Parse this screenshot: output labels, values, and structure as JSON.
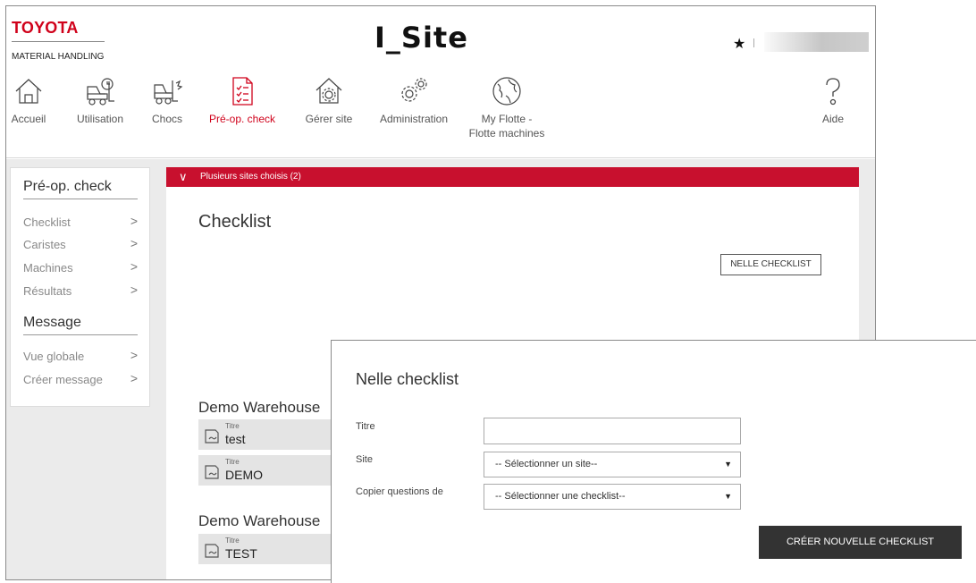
{
  "brand": {
    "name": "TOYOTA",
    "division": "MATERIAL HANDLING"
  },
  "header": {
    "app_title": "I_Site",
    "favorite_symbol": "★"
  },
  "nav": {
    "items": [
      {
        "label": "Accueil",
        "icon": "home-icon"
      },
      {
        "label": "Utilisation",
        "icon": "forklift-clock-icon"
      },
      {
        "label": "Chocs",
        "icon": "forklift-impact-icon"
      },
      {
        "label": "Pré-op. check",
        "icon": "checklist-icon",
        "active": true
      },
      {
        "label": "Gérer site",
        "icon": "house-gear-icon"
      },
      {
        "label": "Administration",
        "icon": "gears-icon"
      },
      {
        "label": "My Flotte -\nFlotte machines",
        "label_line1": "My Flotte -",
        "label_line2": "Flotte machines",
        "icon": "globe-icon"
      },
      {
        "label": "Aide",
        "icon": "help-icon"
      }
    ]
  },
  "sidebar": {
    "section1": {
      "title": "Pré-op. check",
      "items": [
        "Checklist",
        "Caristes",
        "Machines",
        "Résultats"
      ]
    },
    "section2": {
      "title": "Message",
      "items": [
        "Vue globale",
        "Créer message"
      ]
    },
    "chevron": ">"
  },
  "content": {
    "site_selector": "Plusieurs sites choisis (2)",
    "title": "Checklist",
    "new_button": "NELLE CHECKLIST",
    "groups": [
      {
        "name": "Demo Warehouse",
        "cards": [
          {
            "label": "Titre",
            "value": "test"
          },
          {
            "label": "Titre",
            "value": "DEMO"
          }
        ]
      },
      {
        "name": "Demo Warehouse",
        "cards": [
          {
            "label": "Titre",
            "value": "TEST"
          }
        ]
      }
    ]
  },
  "dialog": {
    "title": "Nelle checklist",
    "fields": {
      "titre": {
        "label": "Titre",
        "value": ""
      },
      "site": {
        "label": "Site",
        "value": "-- Sélectionner un site--"
      },
      "copy": {
        "label": "Copier questions de",
        "value": "-- Sélectionner une checklist--"
      }
    },
    "submit": "CRÉER NOUVELLE CHECKLIST"
  },
  "colors": {
    "brand_red": "#d0021b",
    "bar_red": "#c8102e",
    "dark_button": "#333333",
    "page_bg": "#ebebeb"
  }
}
